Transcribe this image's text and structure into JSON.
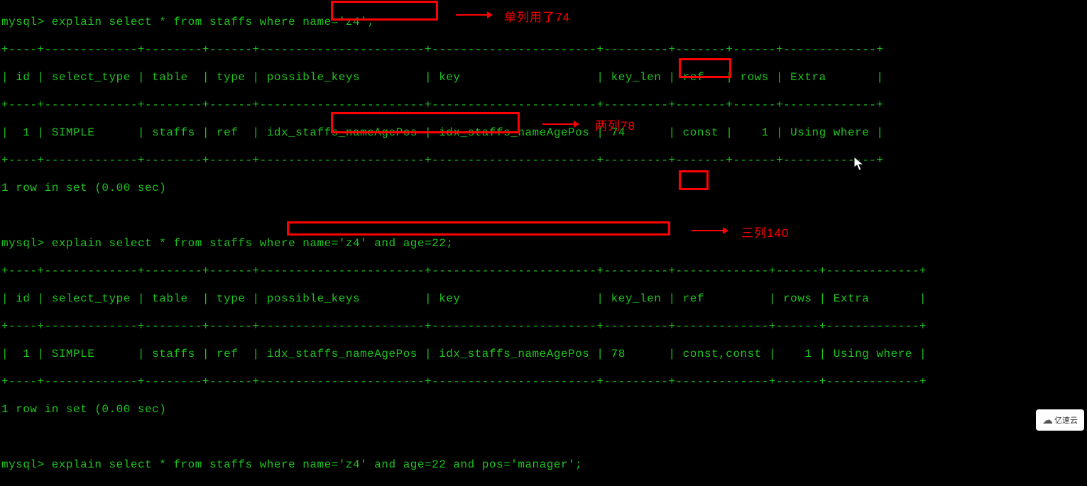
{
  "queries": {
    "q1": {
      "prompt": "mysql> ",
      "sql_pre": "explain select * from staffs where ",
      "sql_boxed": "name='z4';",
      "annotation": "单列用了74",
      "header_line": "| id | select_type | table  | type | possible_keys         | key                   | key_len | ref   | rows | Extra       |",
      "sep_line": "+----+-------------+--------+------+-----------------------+-----------------------+---------+-------+------+-------------+",
      "data_line": "|  1 | SIMPLE      | staffs | ref  | idx_staffs_nameAgePos | idx_staffs_nameAgePos | 74      | const |    1 | Using where |",
      "footer": "1 row in set (0.00 sec)",
      "key_len": "74"
    },
    "q2": {
      "prompt": "mysql> ",
      "sql_pre": "explain select * from staffs where ",
      "sql_boxed": "name='z4' and age=22;",
      "annotation": "两列78",
      "header_line": "| id | select_type | table  | type | possible_keys         | key                   | key_len | ref         | rows | Extra       |",
      "sep_line": "+----+-------------+--------+------+-----------------------+-----------------------+---------+-------------+------+-------------+",
      "data_line": "|  1 | SIMPLE      | staffs | ref  | idx_staffs_nameAgePos | idx_staffs_nameAgePos | 78      | const,const |    1 | Using where |",
      "footer": "1 row in set (0.00 sec)",
      "key_len": "78"
    },
    "q3": {
      "prompt": "mysql> ",
      "sql_pre": "explain select * from staffs ",
      "sql_boxed": "where name='z4' and age=22 and pos='manager';",
      "annotation": "三列140"
    }
  },
  "watermark": "亿速云"
}
